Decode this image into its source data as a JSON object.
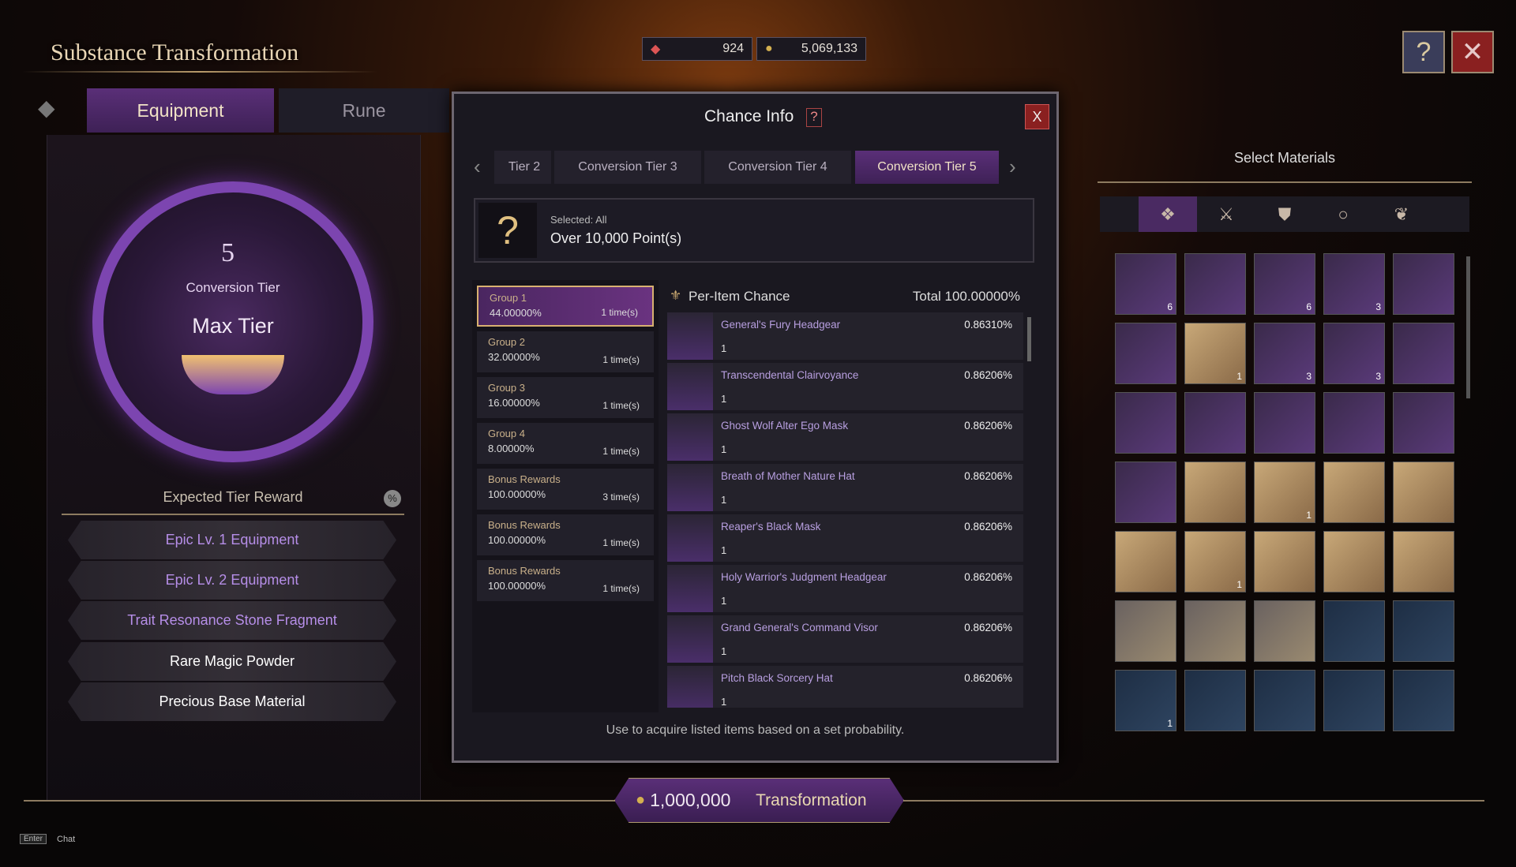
{
  "header": {
    "title": "Substance Transformation",
    "currency_1": "924",
    "currency_2": "5,069,133",
    "help_icon": "help-book-icon",
    "close_icon": "close-x-icon"
  },
  "tabs": [
    {
      "label": "Equipment",
      "active": true
    },
    {
      "label": "Rune",
      "active": false
    }
  ],
  "tier": {
    "number": "5",
    "label": "Conversion Tier",
    "status": "Max Tier"
  },
  "expected": {
    "title": "Expected Tier Reward",
    "percent_icon": "%",
    "items": [
      {
        "label": "Epic Lv. 1 Equipment",
        "color": "#b68ee8"
      },
      {
        "label": "Epic Lv. 2 Equipment",
        "color": "#b68ee8"
      },
      {
        "label": "Trait Resonance Stone Fragment",
        "color": "#b68ee8"
      },
      {
        "label": "Rare Magic Powder",
        "color": "#ffffff"
      },
      {
        "label": "Precious Base Material",
        "color": "#ffffff"
      }
    ]
  },
  "dialog": {
    "title": "Chance Info",
    "help": "?",
    "close": "X",
    "tier_tabs": [
      {
        "label": "Tier 2",
        "visible": "ier 2"
      },
      {
        "label": "Conversion Tier 3"
      },
      {
        "label": "Conversion Tier 4"
      },
      {
        "label": "Conversion Tier 5",
        "active": true
      }
    ],
    "selected_label": "Selected: All",
    "selected_value": "Over 10,000 Point(s)",
    "groups": [
      {
        "name": "Group 1",
        "pct": "44.00000%",
        "times": "1 time(s)",
        "active": true
      },
      {
        "name": "Group 2",
        "pct": "32.00000%",
        "times": "1 time(s)"
      },
      {
        "name": "Group 3",
        "pct": "16.00000%",
        "times": "1 time(s)"
      },
      {
        "name": "Group 4",
        "pct": "8.00000%",
        "times": "1 time(s)"
      },
      {
        "name": "Bonus Rewards",
        "pct": "100.00000%",
        "times": "3 time(s)"
      },
      {
        "name": "Bonus Rewards",
        "pct": "100.00000%",
        "times": "1 time(s)"
      },
      {
        "name": "Bonus Rewards",
        "pct": "100.00000%",
        "times": "1 time(s)"
      }
    ],
    "per_item_label": "Per-Item Chance",
    "total": "Total 100.00000%",
    "items": [
      {
        "name": "General's Fury Headgear",
        "qty": "1",
        "pct": "0.86310%"
      },
      {
        "name": "Transcendental Clairvoyance",
        "qty": "1",
        "pct": "0.86206%"
      },
      {
        "name": "Ghost Wolf Alter Ego Mask",
        "qty": "1",
        "pct": "0.86206%"
      },
      {
        "name": "Breath of Mother Nature Hat",
        "qty": "1",
        "pct": "0.86206%"
      },
      {
        "name": "Reaper's Black Mask",
        "qty": "1",
        "pct": "0.86206%"
      },
      {
        "name": "Holy Warrior's Judgment Headgear",
        "qty": "1",
        "pct": "0.86206%"
      },
      {
        "name": "Grand General's Command Visor",
        "qty": "1",
        "pct": "0.86206%"
      },
      {
        "name": "Pitch Black Sorcery Hat",
        "qty": "1",
        "pct": "0.86206%"
      }
    ],
    "footer": "Use to acquire listed items based on a set probability."
  },
  "materials": {
    "title": "Select Materials",
    "filters": [
      "all-icon",
      "weapon-icon",
      "armor-icon",
      "ring-icon",
      "feather-icon"
    ],
    "grid": [
      [
        {
          "c": "6",
          "bg": "p"
        },
        {
          "c": "",
          "bg": "p"
        },
        {
          "c": "6",
          "bg": "p"
        },
        {
          "c": "3",
          "bg": "p"
        },
        {
          "c": "",
          "bg": "p"
        }
      ],
      [
        {
          "c": "",
          "bg": "p"
        },
        {
          "c": "1",
          "bg": "s"
        },
        {
          "c": "3",
          "bg": "p"
        },
        {
          "c": "3",
          "bg": "p"
        },
        {
          "c": "",
          "bg": "p"
        }
      ],
      [
        {
          "c": "",
          "bg": "p"
        },
        {
          "c": "",
          "bg": "p"
        },
        {
          "c": "",
          "bg": "p"
        },
        {
          "c": "",
          "bg": "p"
        },
        {
          "c": "",
          "bg": "p"
        }
      ],
      [
        {
          "c": "",
          "bg": "p"
        },
        {
          "c": "",
          "bg": "s"
        },
        {
          "c": "1",
          "bg": "s"
        },
        {
          "c": "",
          "bg": "s"
        },
        {
          "c": "",
          "bg": "s"
        }
      ],
      [
        {
          "c": "",
          "bg": "s"
        },
        {
          "c": "1",
          "bg": "s"
        },
        {
          "c": "",
          "bg": "s"
        },
        {
          "c": "",
          "bg": "s"
        },
        {
          "c": "",
          "bg": "s"
        }
      ],
      [
        {
          "c": "",
          "bg": "g"
        },
        {
          "c": "",
          "bg": "g"
        },
        {
          "c": "",
          "bg": "g"
        },
        {
          "c": "",
          "bg": "b"
        },
        {
          "c": "",
          "bg": "b"
        }
      ],
      [
        {
          "c": "1",
          "bg": "b"
        },
        {
          "c": "",
          "bg": "b"
        },
        {
          "c": "",
          "bg": "b"
        },
        {
          "c": "",
          "bg": "b"
        },
        {
          "c": "",
          "bg": "b"
        }
      ]
    ]
  },
  "action": {
    "cost": "1,000,000",
    "label": "Transformation"
  },
  "chat": {
    "key": "Enter",
    "label": "Chat"
  }
}
